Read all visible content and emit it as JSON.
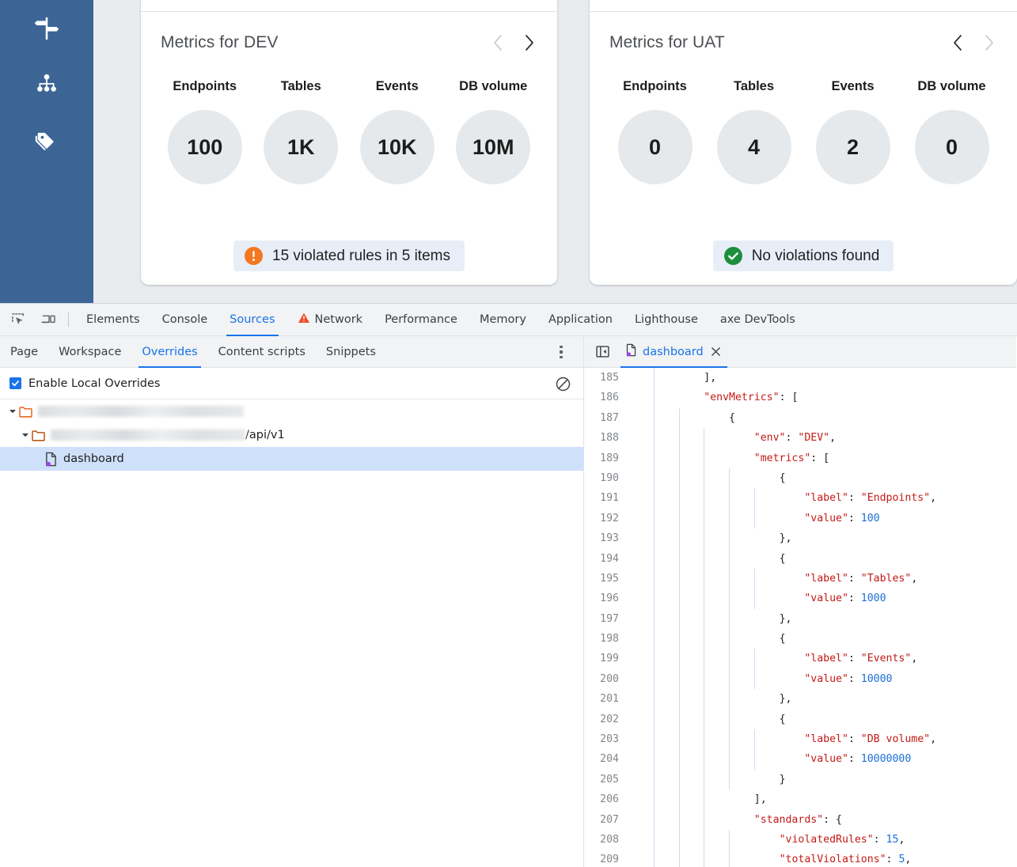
{
  "app": {
    "sidebar": {
      "items": [
        {
          "icon": "signpost-icon",
          "name": "sidebar-item-routes"
        },
        {
          "icon": "sitemap-icon",
          "name": "sidebar-item-hierarchy"
        },
        {
          "icon": "tags-icon",
          "name": "sidebar-item-tags"
        }
      ]
    },
    "cards": [
      {
        "title": "Metrics for DEV",
        "prev_enabled": false,
        "next_enabled": true,
        "metrics": [
          {
            "label": "Endpoints",
            "display": "100"
          },
          {
            "label": "Tables",
            "display": "1K"
          },
          {
            "label": "Events",
            "display": "10K"
          },
          {
            "label": "DB volume",
            "display": "10M"
          }
        ],
        "status": {
          "type": "warning",
          "text": "15 violated rules in 5 items",
          "color": "#f47721"
        }
      },
      {
        "title": "Metrics for UAT",
        "prev_enabled": true,
        "next_enabled": false,
        "metrics": [
          {
            "label": "Endpoints",
            "display": "0"
          },
          {
            "label": "Tables",
            "display": "4"
          },
          {
            "label": "Events",
            "display": "2"
          },
          {
            "label": "DB volume",
            "display": "0"
          }
        ],
        "status": {
          "type": "ok",
          "text": "No violations found",
          "color": "#1e8e3e"
        }
      }
    ]
  },
  "devtools": {
    "toolbar_icons": [
      {
        "name": "inspect-element-icon"
      },
      {
        "name": "device-toolbar-icon"
      }
    ],
    "tabs": [
      {
        "label": "Elements",
        "active": false,
        "warn": false
      },
      {
        "label": "Console",
        "active": false,
        "warn": false
      },
      {
        "label": "Sources",
        "active": true,
        "warn": false
      },
      {
        "label": "Network",
        "active": false,
        "warn": true
      },
      {
        "label": "Performance",
        "active": false,
        "warn": false
      },
      {
        "label": "Memory",
        "active": false,
        "warn": false
      },
      {
        "label": "Application",
        "active": false,
        "warn": false
      },
      {
        "label": "Lighthouse",
        "active": false,
        "warn": false
      },
      {
        "label": "axe DevTools",
        "active": false,
        "warn": false
      }
    ],
    "subtabs": [
      {
        "label": "Page",
        "active": false
      },
      {
        "label": "Workspace",
        "active": false
      },
      {
        "label": "Overrides",
        "active": true
      },
      {
        "label": "Content scripts",
        "active": false
      },
      {
        "label": "Snippets",
        "active": false
      }
    ],
    "overrides": {
      "enable_label": "Enable Local Overrides",
      "enable_checked": true,
      "clear_icon": "clear-overrides-icon",
      "tree": [
        {
          "type": "folder",
          "depth": 0,
          "redacted": true,
          "redacted_width": 260,
          "suffix": "",
          "expanded": true
        },
        {
          "type": "folder",
          "depth": 1,
          "redacted": true,
          "redacted_width": 246,
          "suffix": "/api/v1",
          "expanded": true
        },
        {
          "type": "file",
          "depth": 2,
          "redacted": false,
          "label": "dashboard",
          "selected": true
        }
      ]
    },
    "editor": {
      "panel_toggle_icon": "collapse-navigator-icon",
      "tab_name": "dashboard",
      "tab_close_icon": "close-icon",
      "first_line": 185,
      "lines": [
        {
          "n": 185,
          "indent": 3,
          "guides": 1,
          "tokens": [
            {
              "t": "],",
              "c": "pl"
            }
          ]
        },
        {
          "n": 186,
          "indent": 3,
          "guides": 1,
          "tokens": [
            {
              "t": "\"envMetrics\"",
              "c": "key"
            },
            {
              "t": ": [",
              "c": "pl"
            }
          ]
        },
        {
          "n": 187,
          "indent": 4,
          "guides": 2,
          "tokens": [
            {
              "t": "{",
              "c": "pl"
            }
          ]
        },
        {
          "n": 188,
          "indent": 5,
          "guides": 3,
          "tokens": [
            {
              "t": "\"env\"",
              "c": "key"
            },
            {
              "t": ": ",
              "c": "pl"
            },
            {
              "t": "\"DEV\"",
              "c": "str"
            },
            {
              "t": ",",
              "c": "pl"
            }
          ]
        },
        {
          "n": 189,
          "indent": 5,
          "guides": 3,
          "tokens": [
            {
              "t": "\"metrics\"",
              "c": "key"
            },
            {
              "t": ": [",
              "c": "pl"
            }
          ]
        },
        {
          "n": 190,
          "indent": 6,
          "guides": 4,
          "tokens": [
            {
              "t": "{",
              "c": "pl"
            }
          ]
        },
        {
          "n": 191,
          "indent": 7,
          "guides": 5,
          "tokens": [
            {
              "t": "\"label\"",
              "c": "key"
            },
            {
              "t": ": ",
              "c": "pl"
            },
            {
              "t": "\"Endpoints\"",
              "c": "str"
            },
            {
              "t": ",",
              "c": "pl"
            }
          ]
        },
        {
          "n": 192,
          "indent": 7,
          "guides": 5,
          "tokens": [
            {
              "t": "\"value\"",
              "c": "key"
            },
            {
              "t": ": ",
              "c": "pl"
            },
            {
              "t": "100",
              "c": "num"
            }
          ]
        },
        {
          "n": 193,
          "indent": 6,
          "guides": 4,
          "tokens": [
            {
              "t": "},",
              "c": "pl"
            }
          ]
        },
        {
          "n": 194,
          "indent": 6,
          "guides": 4,
          "tokens": [
            {
              "t": "{",
              "c": "pl"
            }
          ]
        },
        {
          "n": 195,
          "indent": 7,
          "guides": 5,
          "tokens": [
            {
              "t": "\"label\"",
              "c": "key"
            },
            {
              "t": ": ",
              "c": "pl"
            },
            {
              "t": "\"Tables\"",
              "c": "str"
            },
            {
              "t": ",",
              "c": "pl"
            }
          ]
        },
        {
          "n": 196,
          "indent": 7,
          "guides": 5,
          "tokens": [
            {
              "t": "\"value\"",
              "c": "key"
            },
            {
              "t": ": ",
              "c": "pl"
            },
            {
              "t": "1000",
              "c": "num"
            }
          ]
        },
        {
          "n": 197,
          "indent": 6,
          "guides": 4,
          "tokens": [
            {
              "t": "},",
              "c": "pl"
            }
          ]
        },
        {
          "n": 198,
          "indent": 6,
          "guides": 4,
          "tokens": [
            {
              "t": "{",
              "c": "pl"
            }
          ]
        },
        {
          "n": 199,
          "indent": 7,
          "guides": 5,
          "tokens": [
            {
              "t": "\"label\"",
              "c": "key"
            },
            {
              "t": ": ",
              "c": "pl"
            },
            {
              "t": "\"Events\"",
              "c": "str"
            },
            {
              "t": ",",
              "c": "pl"
            }
          ]
        },
        {
          "n": 200,
          "indent": 7,
          "guides": 5,
          "tokens": [
            {
              "t": "\"value\"",
              "c": "key"
            },
            {
              "t": ": ",
              "c": "pl"
            },
            {
              "t": "10000",
              "c": "num"
            }
          ]
        },
        {
          "n": 201,
          "indent": 6,
          "guides": 4,
          "tokens": [
            {
              "t": "},",
              "c": "pl"
            }
          ]
        },
        {
          "n": 202,
          "indent": 6,
          "guides": 4,
          "tokens": [
            {
              "t": "{",
              "c": "pl"
            }
          ]
        },
        {
          "n": 203,
          "indent": 7,
          "guides": 5,
          "tokens": [
            {
              "t": "\"label\"",
              "c": "key"
            },
            {
              "t": ": ",
              "c": "pl"
            },
            {
              "t": "\"DB volume\"",
              "c": "str"
            },
            {
              "t": ",",
              "c": "pl"
            }
          ]
        },
        {
          "n": 204,
          "indent": 7,
          "guides": 5,
          "tokens": [
            {
              "t": "\"value\"",
              "c": "key"
            },
            {
              "t": ": ",
              "c": "pl"
            },
            {
              "t": "10000000",
              "c": "num"
            }
          ]
        },
        {
          "n": 205,
          "indent": 6,
          "guides": 4,
          "tokens": [
            {
              "t": "}",
              "c": "pl"
            }
          ]
        },
        {
          "n": 206,
          "indent": 5,
          "guides": 3,
          "tokens": [
            {
              "t": "],",
              "c": "pl"
            }
          ]
        },
        {
          "n": 207,
          "indent": 5,
          "guides": 3,
          "tokens": [
            {
              "t": "\"standards\"",
              "c": "key"
            },
            {
              "t": ": {",
              "c": "pl"
            }
          ]
        },
        {
          "n": 208,
          "indent": 6,
          "guides": 4,
          "tokens": [
            {
              "t": "\"violatedRules\"",
              "c": "key"
            },
            {
              "t": ": ",
              "c": "pl"
            },
            {
              "t": "15",
              "c": "num"
            },
            {
              "t": ",",
              "c": "pl"
            }
          ]
        },
        {
          "n": 209,
          "indent": 6,
          "guides": 4,
          "tokens": [
            {
              "t": "\"totalViolations\"",
              "c": "key"
            },
            {
              "t": ": ",
              "c": "pl"
            },
            {
              "t": "5",
              "c": "num"
            },
            {
              "t": ",",
              "c": "pl"
            }
          ]
        }
      ]
    }
  }
}
